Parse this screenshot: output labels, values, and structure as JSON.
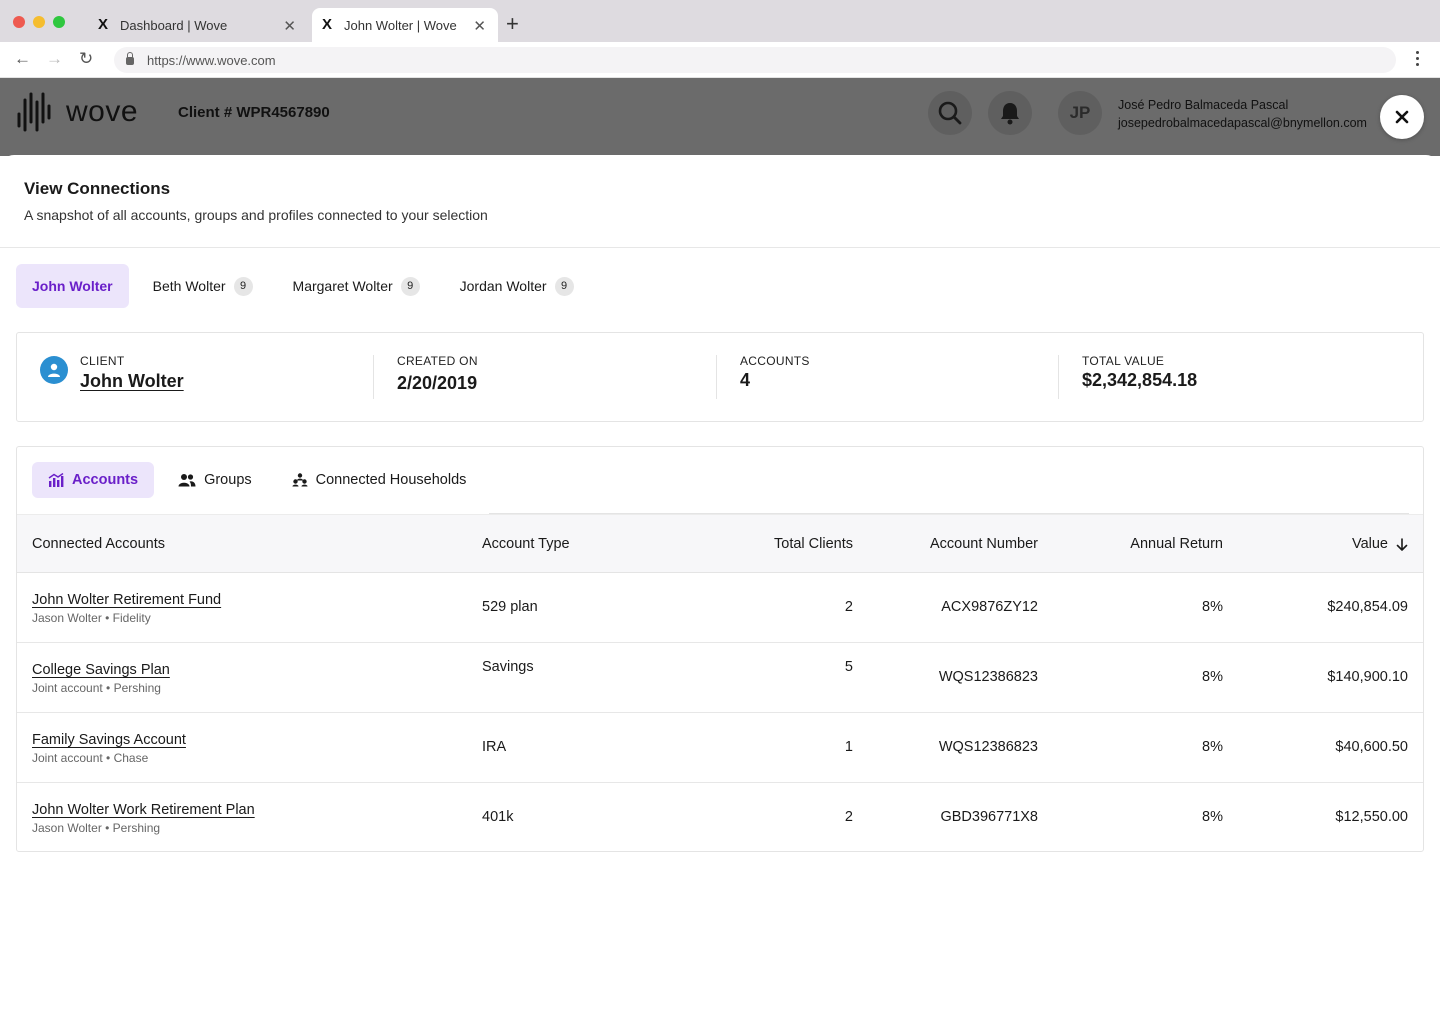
{
  "browser": {
    "tabs": [
      {
        "title": "Dashboard | Wove",
        "active": false
      },
      {
        "title": "John Wolter | Wove",
        "active": true
      }
    ],
    "url": "https://www.wove.com"
  },
  "header": {
    "logo_text": "wove",
    "client_number": "Client # WPR4567890",
    "user": {
      "initials": "JP",
      "name": "José Pedro Balmaceda Pascal",
      "email": "josepedrobalmacedapascal@bnymellon.com"
    }
  },
  "modal": {
    "title": "View Connections",
    "subtitle": "A snapshot of all accounts, groups and profiles connected to your selection",
    "people": [
      {
        "name": "John Wolter",
        "badge": null,
        "active": true
      },
      {
        "name": "Beth Wolter",
        "badge": "9",
        "active": false
      },
      {
        "name": "Margaret Wolter",
        "badge": "9",
        "active": false
      },
      {
        "name": "Jordan Wolter",
        "badge": "9",
        "active": false
      }
    ],
    "summary": {
      "client_label": "CLIENT",
      "client_value": "John Wolter",
      "created_label": "CREATED ON",
      "created_value": "2/20/2019",
      "accounts_label": "ACCOUNTS",
      "accounts_value": "4",
      "total_label": "TOTAL VALUE",
      "total_value": "$2,342,854.18"
    },
    "subtabs": [
      {
        "label": "Accounts",
        "icon": "chart-icon",
        "active": true
      },
      {
        "label": "Groups",
        "icon": "users-icon",
        "active": false
      },
      {
        "label": "Connected Households",
        "icon": "households-icon",
        "active": false
      }
    ],
    "table": {
      "headers": [
        "Connected Accounts",
        "Account Type",
        "Total Clients",
        "Account Number",
        "Annual Return",
        "Value"
      ],
      "rows": [
        {
          "name": "John Wolter Retirement Fund",
          "meta": "Jason Wolter • Fidelity",
          "type": "529 plan",
          "clients": "2",
          "number": "ACX9876ZY12",
          "return": "8%",
          "value": "$240,854.09"
        },
        {
          "name": "College Savings Plan",
          "meta": "Joint account • Pershing",
          "type": "Savings",
          "clients": "5",
          "number": "WQS12386823",
          "return": "8%",
          "value": "$140,900.10"
        },
        {
          "name": "Family Savings Account",
          "meta": "Joint account • Chase",
          "type": "IRA",
          "clients": "1",
          "number": "WQS12386823",
          "return": "8%",
          "value": "$40,600.50"
        },
        {
          "name": "John Wolter Work Retirement Plan",
          "meta": "Jason Wolter • Pershing",
          "type": "401k",
          "clients": "2",
          "number": "GBD396771X8",
          "return": "8%",
          "value": "$12,550.00"
        }
      ]
    }
  },
  "colors": {
    "accent": "#6a1fc9",
    "accent_bg": "#ece5fb",
    "client_icon": "#2b8fd1"
  }
}
